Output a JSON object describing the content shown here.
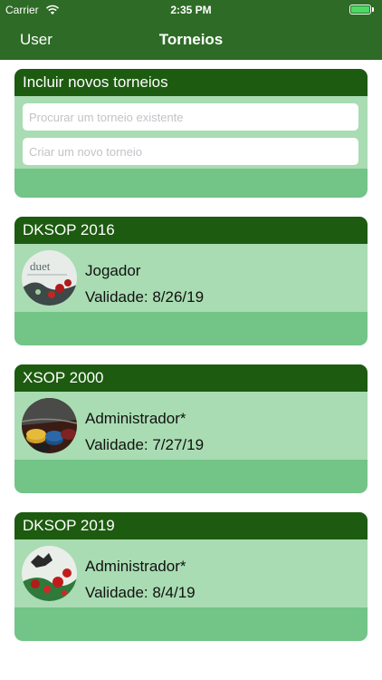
{
  "status_bar": {
    "carrier": "Carrier",
    "time": "2:35 PM",
    "battery_level": 0.85
  },
  "nav": {
    "back_label": "User",
    "title": "Torneios"
  },
  "new_section": {
    "header": "Incluir novos torneios",
    "search_placeholder": "Procurar um torneio existente",
    "create_placeholder": "Criar um novo torneio"
  },
  "tournaments": [
    {
      "name": "DKSOP 2016",
      "role": "Jogador",
      "validity": "Validade: 8/26/19",
      "logo_text": "duet"
    },
    {
      "name": "XSOP 2000",
      "role": "Administrador*",
      "validity": "Validade: 7/27/19"
    },
    {
      "name": "DKSOP 2019",
      "role": "Administrador*",
      "validity": "Validade: 8/4/19"
    }
  ],
  "colors": {
    "nav": "#2e6b26",
    "card_header": "#1d5b10",
    "card_body": "#a9dcb2",
    "card_footer": "#72c487"
  }
}
